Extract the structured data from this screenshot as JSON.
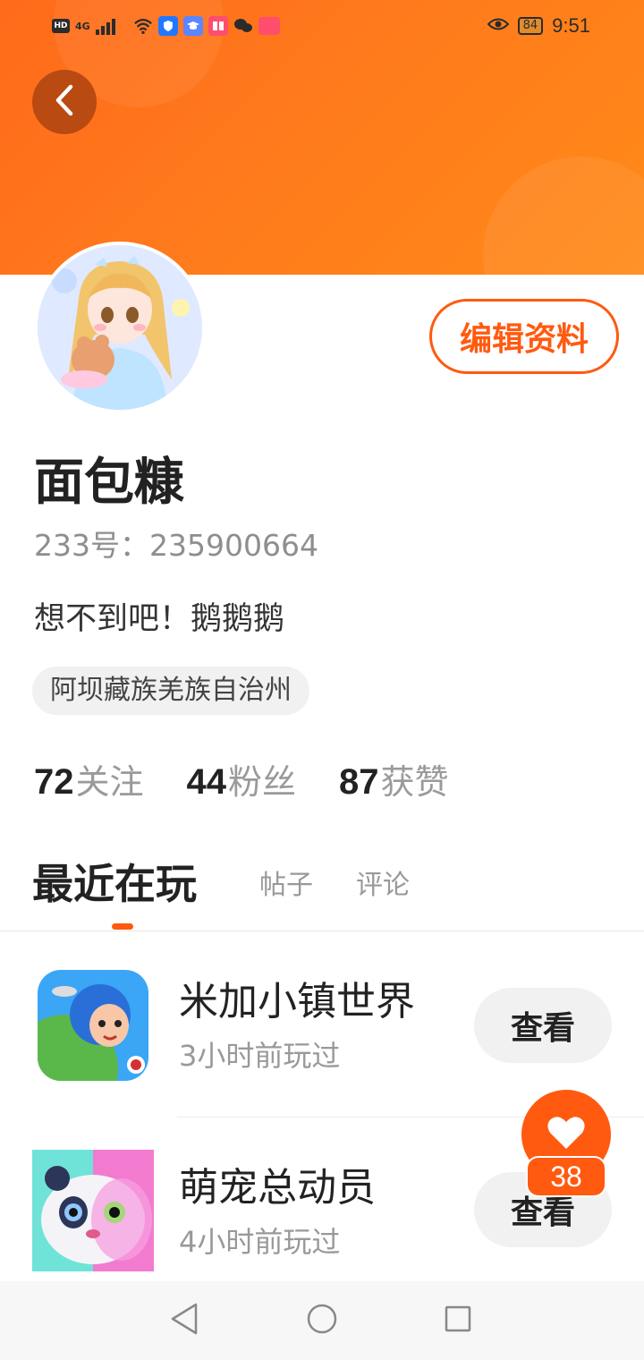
{
  "status_bar": {
    "hd": "HD",
    "network": "4G",
    "battery": "84",
    "time": "9:51"
  },
  "profile": {
    "edit_label": "编辑资料",
    "name": "面包糠",
    "id_text": "233号：235900664",
    "bio": "想不到吧！鹅鹅鹅",
    "location": "阿坝藏族羌族自治州"
  },
  "stats": [
    {
      "value": "72",
      "label": "关注"
    },
    {
      "value": "44",
      "label": "粉丝"
    },
    {
      "value": "87",
      "label": "获赞"
    }
  ],
  "tabs": [
    {
      "label": "最近在玩",
      "active": true
    },
    {
      "label": "帖子",
      "active": false
    },
    {
      "label": "评论",
      "active": false
    }
  ],
  "games": [
    {
      "title": "米加小镇世界",
      "subtitle": "3小时前玩过",
      "button": "查看"
    },
    {
      "title": "萌宠总动员",
      "subtitle": "4小时前玩过",
      "button": "查看"
    }
  ],
  "likes": {
    "count": "38"
  },
  "colors": {
    "accent": "#ff5a10",
    "header": "#ff7a1c"
  }
}
